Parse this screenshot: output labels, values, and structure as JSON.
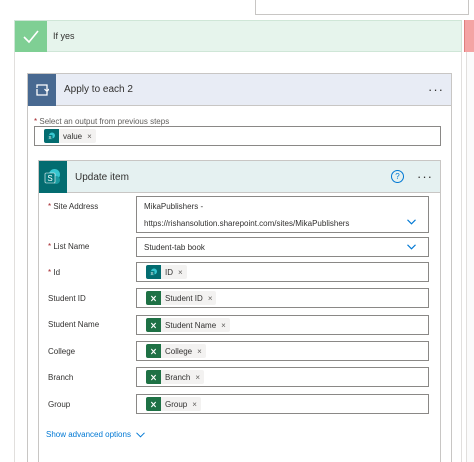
{
  "condition": {
    "label": "If yes"
  },
  "loop": {
    "title": "Apply to each 2",
    "select_label": "Select an output from previous steps",
    "select_token": "value"
  },
  "action": {
    "title": "Update item",
    "fields": {
      "site_address": {
        "label": "Site Address",
        "line1": "MikaPublishers -",
        "line2": "https://rishansolution.sharepoint.com/sites/MikaPublishers"
      },
      "list_name": {
        "label": "List Name",
        "value": "Student-tab book"
      },
      "id": {
        "label": "Id",
        "token": "ID"
      },
      "student_id": {
        "label": "Student ID",
        "token": "Student ID"
      },
      "student_name": {
        "label": "Student Name",
        "token": "Student Name"
      },
      "college": {
        "label": "College",
        "token": "College"
      },
      "branch": {
        "label": "Branch",
        "token": "Branch"
      },
      "group": {
        "label": "Group",
        "token": "Group"
      }
    },
    "advanced_label": "Show advanced options"
  },
  "symbols": {
    "required": "*",
    "remove": "×",
    "help": "?",
    "more": "···"
  },
  "colors": {
    "condition_green": "#7fcf94",
    "loop_blue": "#486991",
    "sharepoint_teal": "#036c70",
    "excel_green": "#1e7145",
    "link_blue": "#0078d4"
  },
  "icons": {
    "condition": "checkmark-icon",
    "loop": "loop-icon",
    "sharepoint": "sharepoint-icon",
    "excel": "excel-icon",
    "help": "help-circle-icon",
    "dropdown": "chevron-down-icon"
  }
}
